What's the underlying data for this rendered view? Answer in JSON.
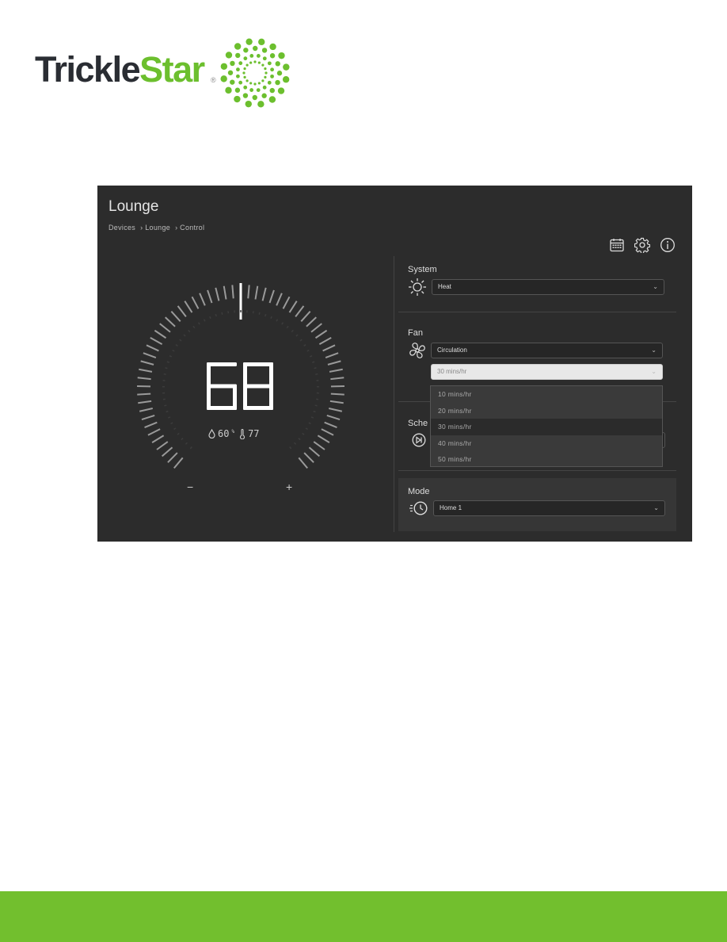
{
  "brand": {
    "name_part1": "Trickle",
    "name_part2": "Star",
    "registered": "®",
    "green": "#6cbf2e",
    "dark": "#2a2d33"
  },
  "page": {
    "title": "Lounge",
    "breadcrumb": [
      "Devices",
      "› Lounge",
      "› Control"
    ]
  },
  "toolbar": {
    "icons": [
      "calendar-icon",
      "gear-icon",
      "info-icon"
    ]
  },
  "dial": {
    "setpoint": "68",
    "humidity": "60",
    "humidity_unit": "%",
    "temperature": "77",
    "minus": "−",
    "plus": "+"
  },
  "system": {
    "label": "System",
    "value": "Heat"
  },
  "fan": {
    "label": "Fan",
    "value": "Circulation",
    "rate_value": "30 mins/hr",
    "options": [
      "10 mins/hr",
      "20 mins/hr",
      "30 mins/hr",
      "40 mins/hr",
      "50 mins/hr"
    ],
    "highlighted": 2
  },
  "schedule": {
    "label": "Sche"
  },
  "mode": {
    "label": "Mode",
    "value": "Home 1"
  },
  "footer_color": "#72bf2e"
}
